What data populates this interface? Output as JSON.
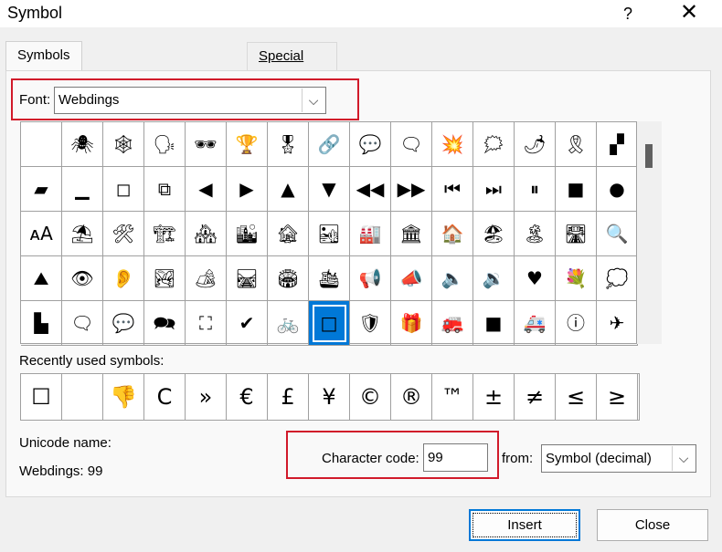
{
  "window": {
    "title": "Symbol",
    "help": "?",
    "close": "✕"
  },
  "tabs": [
    {
      "label": "Symbols",
      "selected": true
    },
    {
      "label": "Special Characters",
      "selected": false
    }
  ],
  "font": {
    "label": "Font:",
    "value": "Webdings"
  },
  "symbol_grid": {
    "rows": [
      [
        " ",
        "🕷",
        "🕸",
        "🗣",
        "🕶",
        "🏆",
        "🎖",
        "🔗",
        "💬",
        "🗨",
        "💥",
        "🗯",
        "🌶",
        "🎗",
        "▞"
      ],
      [
        "▰",
        "▁",
        "◻",
        "⧉",
        "◀",
        "▶",
        "▲",
        "▼",
        "◀◀",
        "▶▶",
        "⏮",
        "⏭",
        "⏸",
        "■",
        "●"
      ],
      [
        "ᴀA",
        "⛱",
        "🛠",
        "🏗",
        "🏘",
        "🏙",
        "🏚",
        "🏜",
        "🏭",
        "🏛",
        "🏠",
        "🏖",
        "🏝",
        "🛣",
        "🔍"
      ],
      [
        "⛰",
        "👁",
        "👂",
        "🏞",
        "🏕",
        "🛤",
        "🏟",
        "🛳",
        "📢",
        "📣",
        "🔈",
        "🔉",
        "♥",
        "💐",
        "💭"
      ],
      [
        "▙",
        "🗨",
        "💬",
        "🗪",
        "⛶",
        "✔",
        "🚲",
        "□",
        "🛡",
        "🎁",
        "🚒",
        "■",
        "🚑",
        "ⓘ",
        "✈"
      ]
    ],
    "selected": {
      "row": 4,
      "col": 7
    }
  },
  "recent": {
    "label": "Recently used symbols:",
    "items": [
      "☐",
      " ",
      "👎",
      "C",
      "»",
      "€",
      "£",
      "¥",
      "©",
      "®",
      "™",
      "±",
      "≠",
      "≤",
      "≥"
    ]
  },
  "unicode": {
    "label": "Unicode name:",
    "value": "Webdings: 99"
  },
  "character_code": {
    "label": "Character code:",
    "value": "99"
  },
  "from": {
    "label": "from:",
    "value": "Symbol (decimal)"
  },
  "buttons": {
    "insert": "Insert",
    "close": "Close"
  },
  "colors": {
    "accent": "#0078d7",
    "highlight": "#d11a2a"
  }
}
